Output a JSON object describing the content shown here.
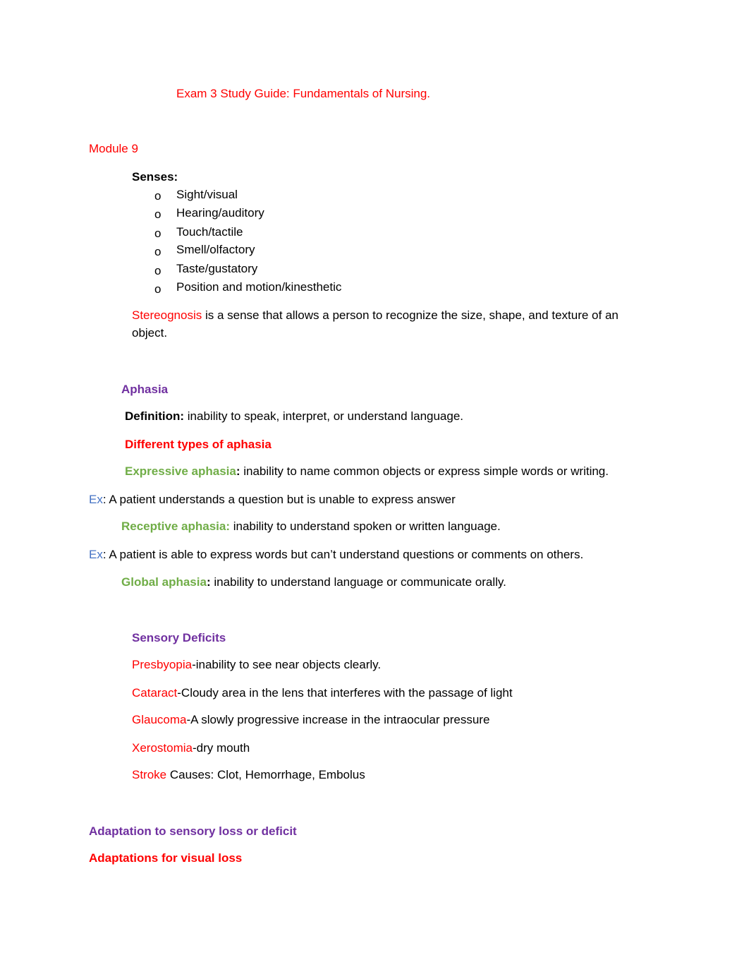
{
  "document": {
    "title": "Exam 3 Study Guide: Fundamentals of Nursing.",
    "module_heading": "Module 9",
    "senses": {
      "heading": "Senses:",
      "bullet_glyph": "o",
      "items": [
        "Sight/visual",
        "Hearing/auditory",
        "Touch/tactile",
        "Smell/olfactory",
        "Taste/gustatory",
        "Position and motion/kinesthetic"
      ]
    },
    "stereognosis": {
      "term": "Stereognosis",
      "text": " is a sense that allows a person to recognize the size, shape, and texture of an object."
    },
    "aphasia": {
      "heading": "Aphasia",
      "definition_label": "Definition:",
      "definition_text": " inability to speak, interpret, or understand language.",
      "types_heading": "Different types of aphasia",
      "expressive": {
        "term": "Expressive aphasia",
        "colon": ":",
        "text": " inability to name common objects or express simple words or writing."
      },
      "expressive_example": {
        "label": "Ex",
        "text": ": A patient understands a question but is unable to express answer"
      },
      "receptive": {
        "term": "Receptive aphasia:",
        "text": " inability to understand spoken or written language."
      },
      "receptive_example": {
        "label": "Ex",
        "text": ": A patient is able to express words but can’t understand questions or comments on others."
      },
      "global": {
        "term": "Global aphasia",
        "colon": ":",
        "text": " inability to understand language or communicate orally."
      }
    },
    "sensory_deficits": {
      "heading": "Sensory Deficits",
      "items": [
        {
          "term": "Presbyopia",
          "text": "-inability to see near objects clearly."
        },
        {
          "term": "Cataract",
          "text": "-Cloudy area in the lens that interferes with the passage of light"
        },
        {
          "term": "Glaucoma",
          "text": "-A slowly progressive increase in the intraocular pressure"
        },
        {
          "term": "Xerostomia",
          "text": "-dry mouth"
        },
        {
          "term": "Stroke",
          "text": " Causes: Clot, Hemorrhage, Embolus"
        }
      ]
    },
    "adaptation_heading": "Adaptation to sensory loss or deficit",
    "visual_loss_heading": "Adaptations for visual loss"
  },
  "colors": {
    "red": "#ff0000",
    "purple": "#7030a0",
    "green": "#70ad47",
    "blue": "#4472c4",
    "text": "#000000"
  }
}
